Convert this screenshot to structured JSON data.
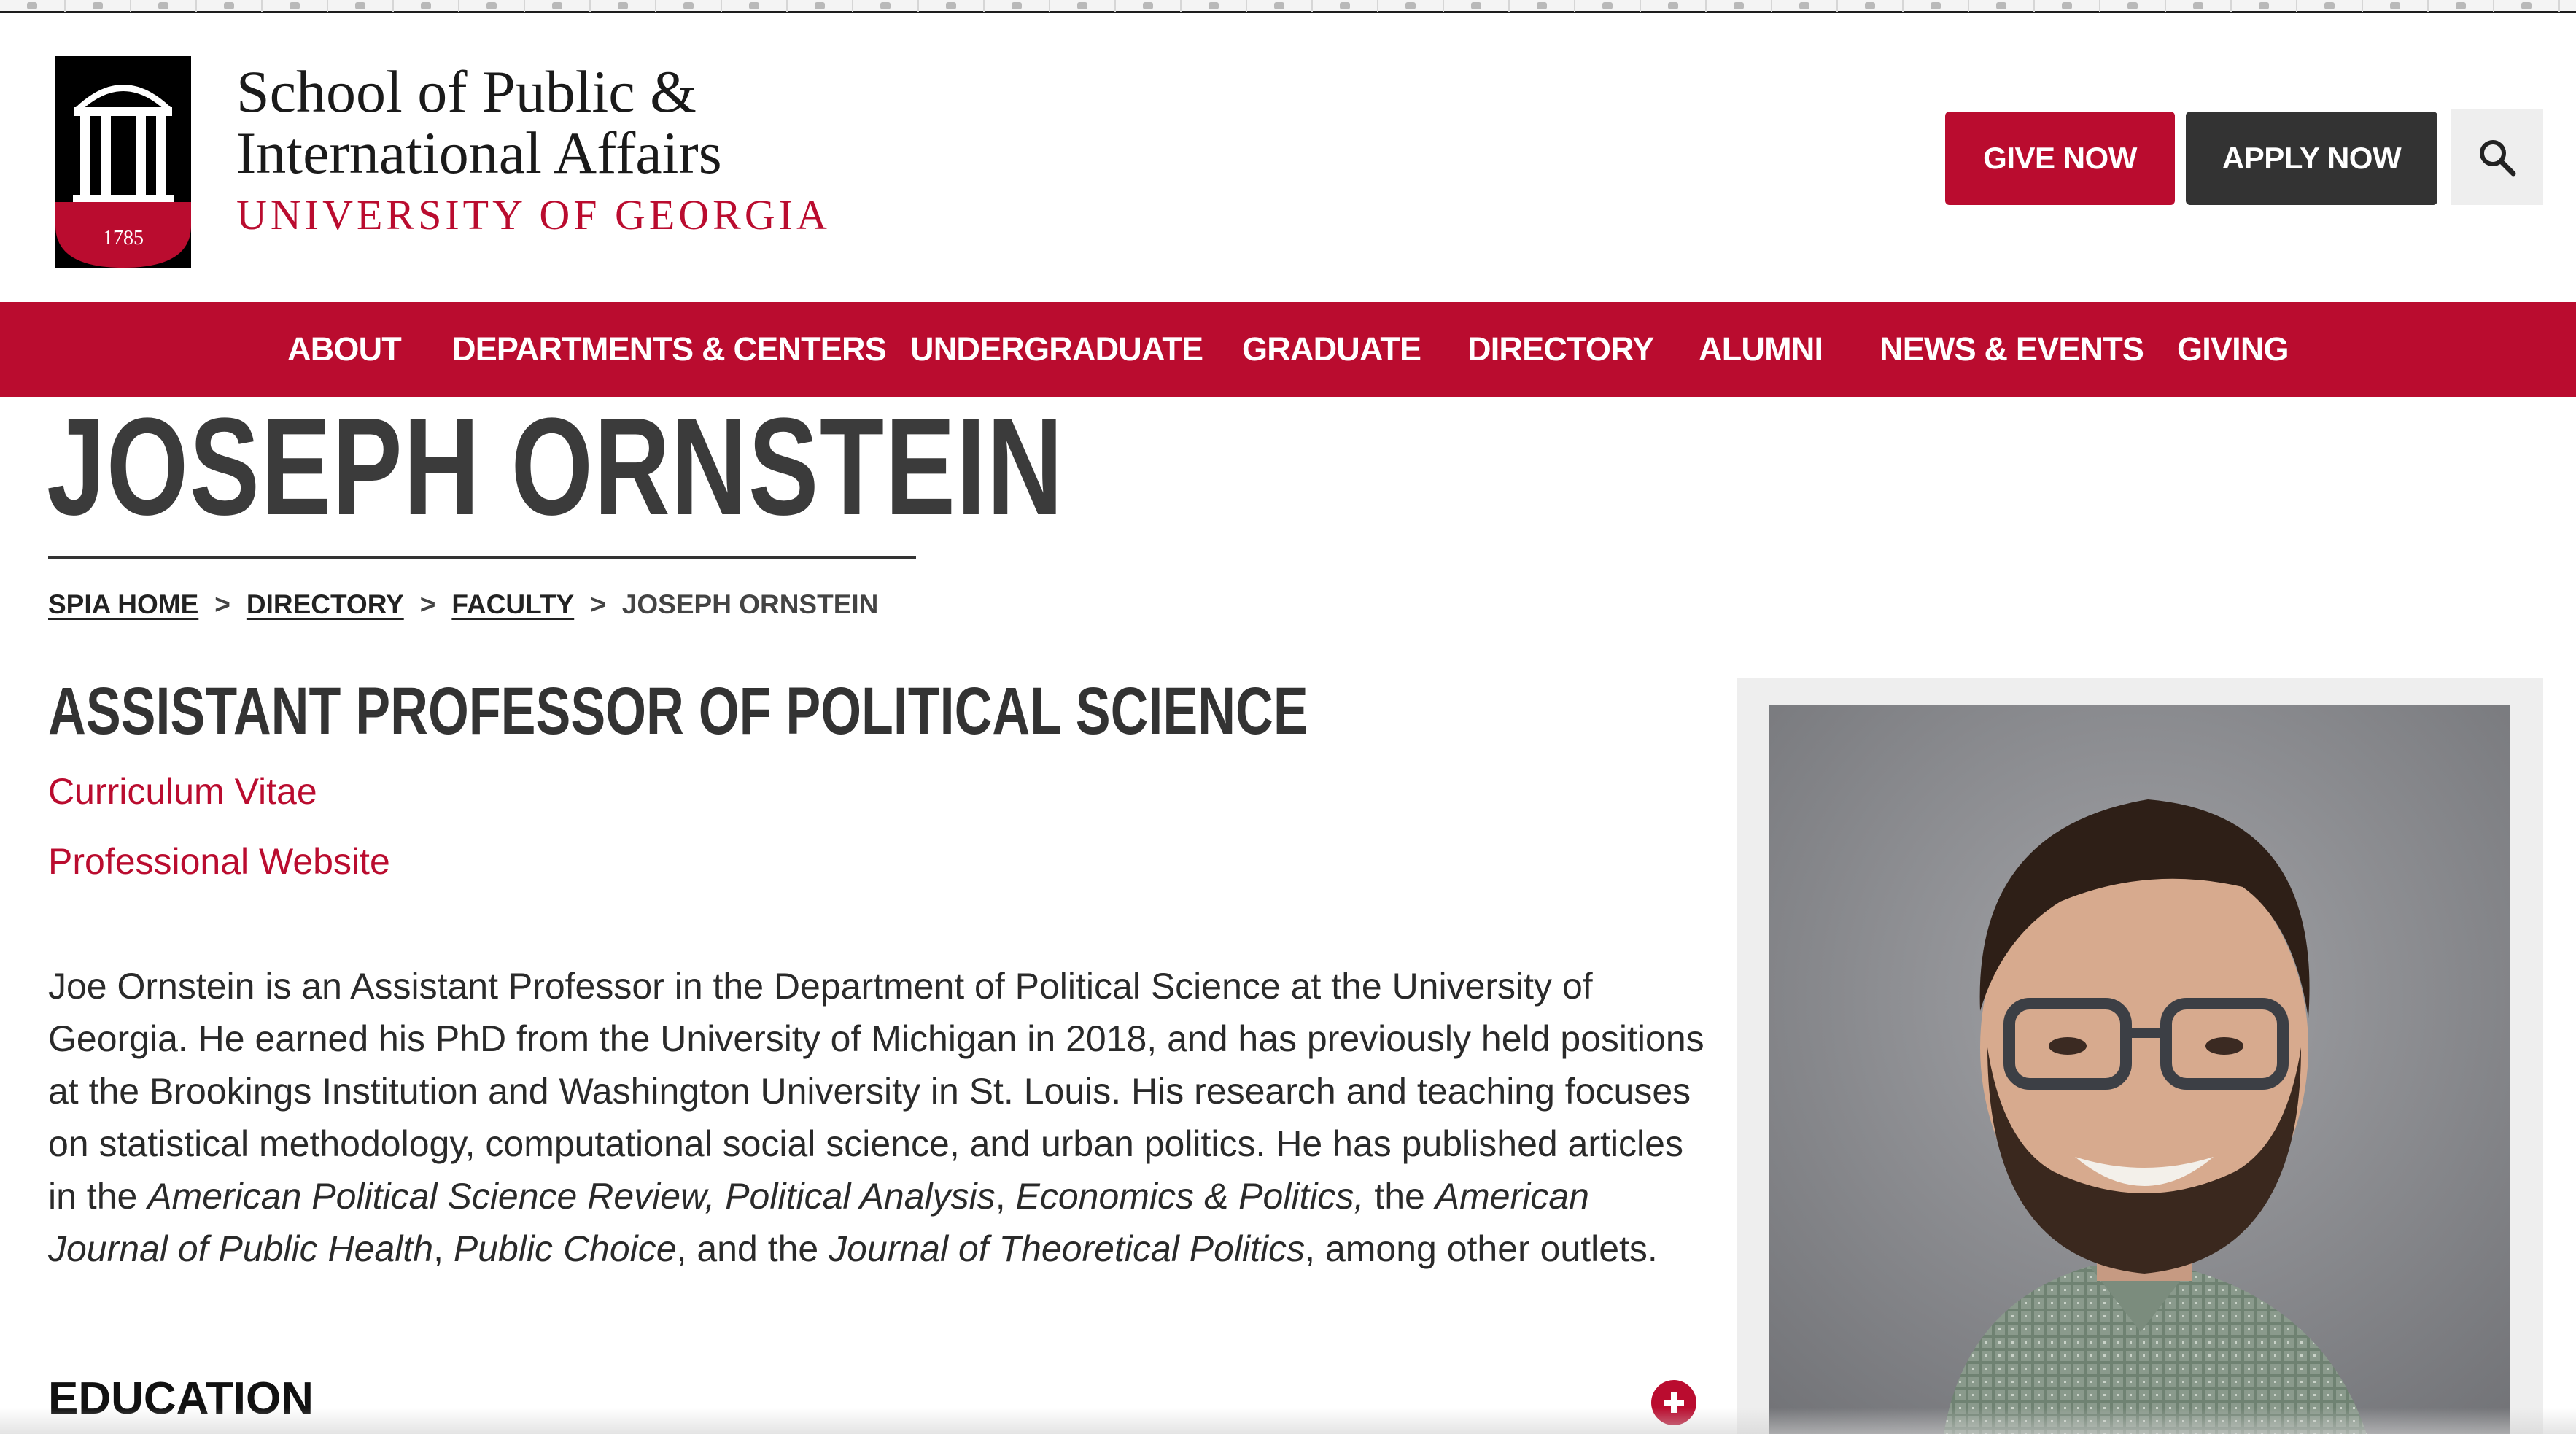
{
  "browser": {
    "bookmark_icons": [
      "bookmark-icon",
      "bookmark-icon",
      "bookmark-icon",
      "bookmark-icon",
      "bookmark-icon",
      "bookmark-icon",
      "bookmark-icon",
      "bookmark-icon",
      "bookmark-icon",
      "bookmark-icon",
      "bookmark-icon",
      "bookmark-icon",
      "bookmark-icon",
      "bookmark-icon",
      "bookmark-icon",
      "bookmark-icon",
      "bookmark-icon",
      "bookmark-icon",
      "bookmark-icon",
      "bookmark-icon",
      "bookmark-icon",
      "bookmark-icon",
      "bookmark-icon",
      "bookmark-icon",
      "bookmark-icon",
      "bookmark-icon",
      "bookmark-icon",
      "bookmark-icon",
      "bookmark-icon",
      "bookmark-icon",
      "bookmark-icon",
      "bookmark-icon",
      "bookmark-icon",
      "bookmark-icon",
      "bookmark-icon",
      "bookmark-icon",
      "bookmark-icon",
      "bookmark-icon",
      "bookmark-icon"
    ]
  },
  "header": {
    "logo_year": "1785",
    "logo_icon": "arch-logo-icon",
    "brand_line1": "School of Public &",
    "brand_line2": "International Affairs",
    "brand_line3": "UNIVERSITY OF GEORGIA",
    "give_label": "GIVE NOW",
    "apply_label": "APPLY NOW",
    "search_icon": "search-icon"
  },
  "nav": {
    "items": [
      {
        "label": "ABOUT"
      },
      {
        "label": "DEPARTMENTS & CENTERS"
      },
      {
        "label": "UNDERGRADUATE"
      },
      {
        "label": "GRADUATE"
      },
      {
        "label": "DIRECTORY"
      },
      {
        "label": "ALUMNI"
      },
      {
        "label": "NEWS & EVENTS"
      },
      {
        "label": "GIVING"
      }
    ]
  },
  "page": {
    "title": "JOSEPH ORNSTEIN",
    "breadcrumb": [
      {
        "label": "SPIA HOME"
      },
      {
        "label": "DIRECTORY"
      },
      {
        "label": "FACULTY"
      },
      {
        "label": "JOSEPH ORNSTEIN"
      }
    ],
    "breadcrumb_separator": ">",
    "job_title": "ASSISTANT PROFESSOR OF POLITICAL SCIENCE",
    "links": {
      "cv": "Curriculum Vitae",
      "website": "Professional Website"
    },
    "bio": {
      "t1": "Joe Ornstein is an Assistant Professor in the Department of Political Science at the University of Georgia. He earned his PhD from the University of Michigan in 2018, and has previously held positions at the Brookings Institution and Washington University in St. Louis. His research and teaching focuses on statistical methodology, computational social science, and urban politics. He has published articles in the ",
      "i1": "American Political Science Review, Political Analysis",
      "t2": ", ",
      "i2": "Economics & Politics,",
      "t3": " the ",
      "i3": "American Journal of Public Health",
      "t4": ", ",
      "i4": "Public Choice",
      "t5": ", and the ",
      "i5": "Journal of Theoretical Politics",
      "t6": ", among other outlets."
    },
    "education_heading": "EDUCATION",
    "education_toggle_icon": "plus-circle-icon"
  },
  "colors": {
    "brand_red": "#ba0c2f",
    "dark_button": "#333333",
    "text": "#222222"
  }
}
